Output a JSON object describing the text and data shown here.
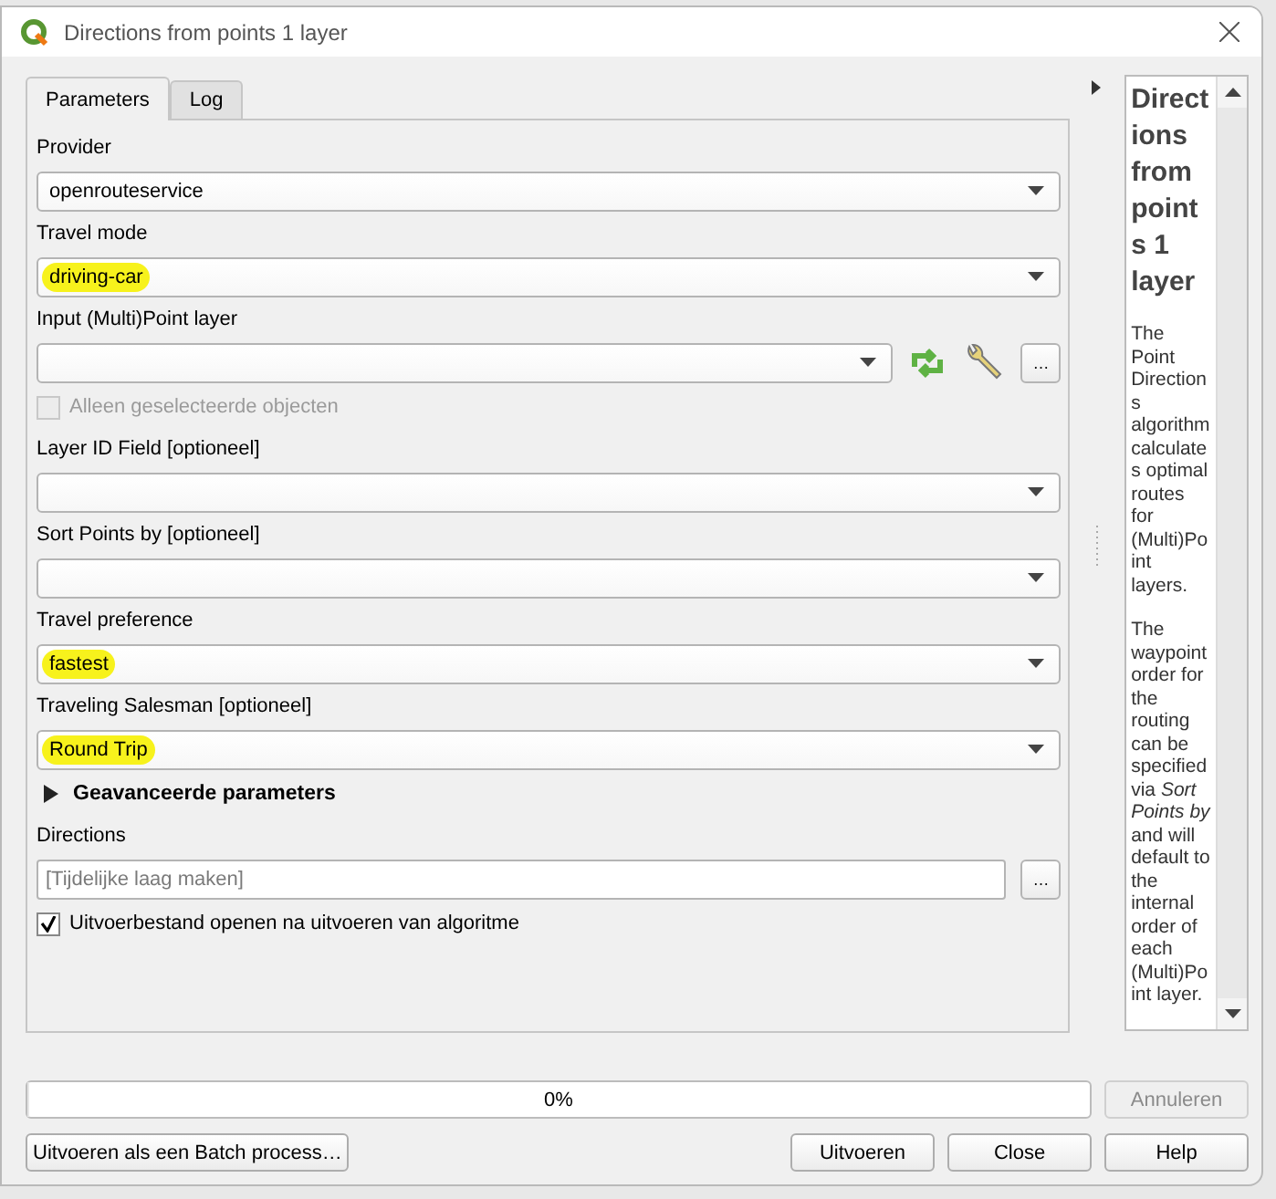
{
  "window": {
    "title": "Directions from points 1 layer"
  },
  "tabs": [
    {
      "label": "Parameters",
      "selected": true
    },
    {
      "label": "Log",
      "selected": false
    }
  ],
  "fields": [
    {
      "kind": "combo",
      "label": "Provider",
      "value": "openrouteservice"
    },
    {
      "kind": "combo",
      "label": "Travel mode",
      "value": "driving-car",
      "highlighted": true
    },
    {
      "kind": "layer",
      "label": "Input (Multi)Point layer",
      "browse": "…"
    },
    {
      "kind": "checkbox",
      "label": "Alleen geselecteerde objecten",
      "checked": false,
      "disabled": true
    },
    {
      "kind": "combo",
      "label": "Layer ID Field [optioneel]"
    },
    {
      "kind": "combo",
      "label": "Sort Points by [optioneel]"
    },
    {
      "kind": "combo",
      "label": "Travel preference",
      "value": "fastest",
      "highlighted": true
    },
    {
      "kind": "combo",
      "label": "Traveling Salesman [optioneel]",
      "value": "Round Trip",
      "highlighted": true
    },
    {
      "kind": "expander",
      "label": "Geavanceerde parameters",
      "expanded": false
    },
    {
      "kind": "output",
      "label": "Directions",
      "placeholder": "[Tijdelijke laag maken]",
      "browse": "…"
    },
    {
      "kind": "checkbox",
      "label": "Uitvoerbestand openen na uitvoeren van algoritme",
      "checked": true,
      "disabled": false
    }
  ],
  "help": {
    "title": "Directions from points 1 layer",
    "paragraphs": [
      "The Point Directions algorithm calculates optimal routes for (Multi)Point layers.",
      "The waypoint order for the routing can be specified via *Sort Points by* and will default to the internal order of each (Multi)Point layer."
    ]
  },
  "progress": {
    "level": 0,
    "text": "0%"
  },
  "cancel_button": {
    "label": "Annuleren",
    "disabled": true
  },
  "batch_button": {
    "label": "Uitvoeren als een Batch process…"
  },
  "buttons": [
    {
      "label": "Uitvoeren"
    },
    {
      "label": "Close"
    },
    {
      "label": "Help"
    }
  ]
}
